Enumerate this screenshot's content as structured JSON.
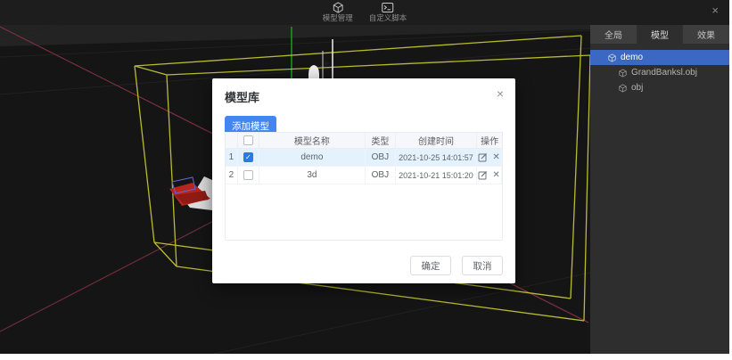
{
  "topbar": {
    "tools": [
      {
        "icon": "cube-icon",
        "label": "模型管理"
      },
      {
        "icon": "terminal-icon",
        "label": "自定义脚本"
      }
    ]
  },
  "icons": {
    "close": "×",
    "check": "✓",
    "delete": "✕"
  },
  "dialog": {
    "title": "模型库",
    "add_button": "添加模型",
    "table": {
      "columns": [
        "模型名称",
        "类型",
        "创建时间",
        "操作"
      ],
      "rows": [
        {
          "index": "1",
          "checked": true,
          "name": "demo",
          "type": "OBJ",
          "created": "2021-10-25 14:01:57"
        },
        {
          "index": "2",
          "checked": false,
          "name": "3d",
          "type": "OBJ",
          "created": "2021-10-21 15:01:20"
        }
      ]
    },
    "confirm_label": "确定",
    "cancel_label": "取消"
  },
  "sidebar": {
    "tabs": [
      {
        "label": "全局",
        "active": false
      },
      {
        "label": "模型",
        "active": true
      },
      {
        "label": "效果",
        "active": false
      }
    ],
    "tree": [
      {
        "label": "demo",
        "selected": true,
        "level": 0
      },
      {
        "label": "GrandBanksl.obj",
        "selected": false,
        "level": 1
      },
      {
        "label": "obj",
        "selected": false,
        "level": 1
      }
    ]
  },
  "colors": {
    "accent_blue": "#4486ef",
    "checkbox_blue": "#2b7ce0",
    "selected_row": "#e4f2fe",
    "tree_selected": "#3a68c2",
    "wireframe_yellow": "#b9bb2f",
    "axis_green": "#1fa321",
    "axis_red": "#7c3140",
    "viewport_bg": "#151515",
    "sidebar_bg": "#2e2e2e"
  }
}
